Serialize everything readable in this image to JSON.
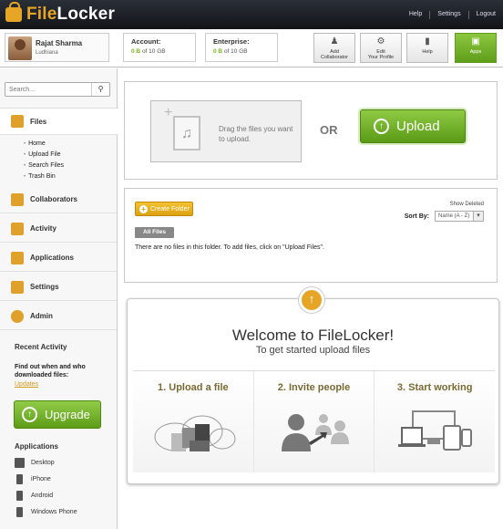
{
  "app": {
    "name_prefix": "File",
    "name_suffix": "Locker"
  },
  "top_links": [
    "Help",
    "Settings",
    "Logout"
  ],
  "user": {
    "name": "Rajat Sharma",
    "location": "Ludhiana"
  },
  "account": {
    "label": "Account:",
    "used": "0 B",
    "total": "of 10 GB"
  },
  "enterprise": {
    "label": "Enterprise:",
    "used": "0 B",
    "total": "of 10 GB"
  },
  "toolbar": [
    {
      "label": "Add\nCollaborator",
      "icon": "add-user-icon"
    },
    {
      "label": "Edit\nYour Profile",
      "icon": "gear-icon"
    },
    {
      "label": "Help",
      "icon": "help-icon"
    },
    {
      "label": "Apps",
      "icon": "apps-icon"
    }
  ],
  "search": {
    "placeholder": "Search..."
  },
  "nav": {
    "files": "Files",
    "files_sub": [
      "Home",
      "Upload File",
      "Search Files",
      "Trash Bin"
    ],
    "collaborators": "Collaborators",
    "activity": "Activity",
    "applications": "Applications",
    "settings": "Settings",
    "admin": "Admin"
  },
  "recent_activity": {
    "title": "Recent Activity",
    "text": "Find out when and who downloaded files:",
    "link": "Updates"
  },
  "upgrade_label": "Upgrade",
  "applications_list": {
    "title": "Applications",
    "items": [
      "Desktop",
      "iPhone",
      "Android",
      "Windows Phone"
    ]
  },
  "upload": {
    "drop_text": "Drag the files you want to upload.",
    "or": "OR",
    "button": "Upload"
  },
  "files_panel": {
    "create_folder": "Create Folder",
    "show_deleted": "Show Deleted",
    "sort_by": "Sort By:",
    "sort_value": "Name (A - Z)",
    "all_files": "All Files",
    "empty_message": "There are no files in this folder.   To add files, click on \"Upload Files\"."
  },
  "welcome": {
    "title": "Welcome to FileLocker!",
    "subtitle": "To get started upload files",
    "steps": [
      "1. Upload a file",
      "2. Invite people",
      "3. Start working"
    ]
  },
  "colors": {
    "accent": "#e7a526",
    "green": "#6aab22",
    "topbar": "#1c1f25"
  }
}
